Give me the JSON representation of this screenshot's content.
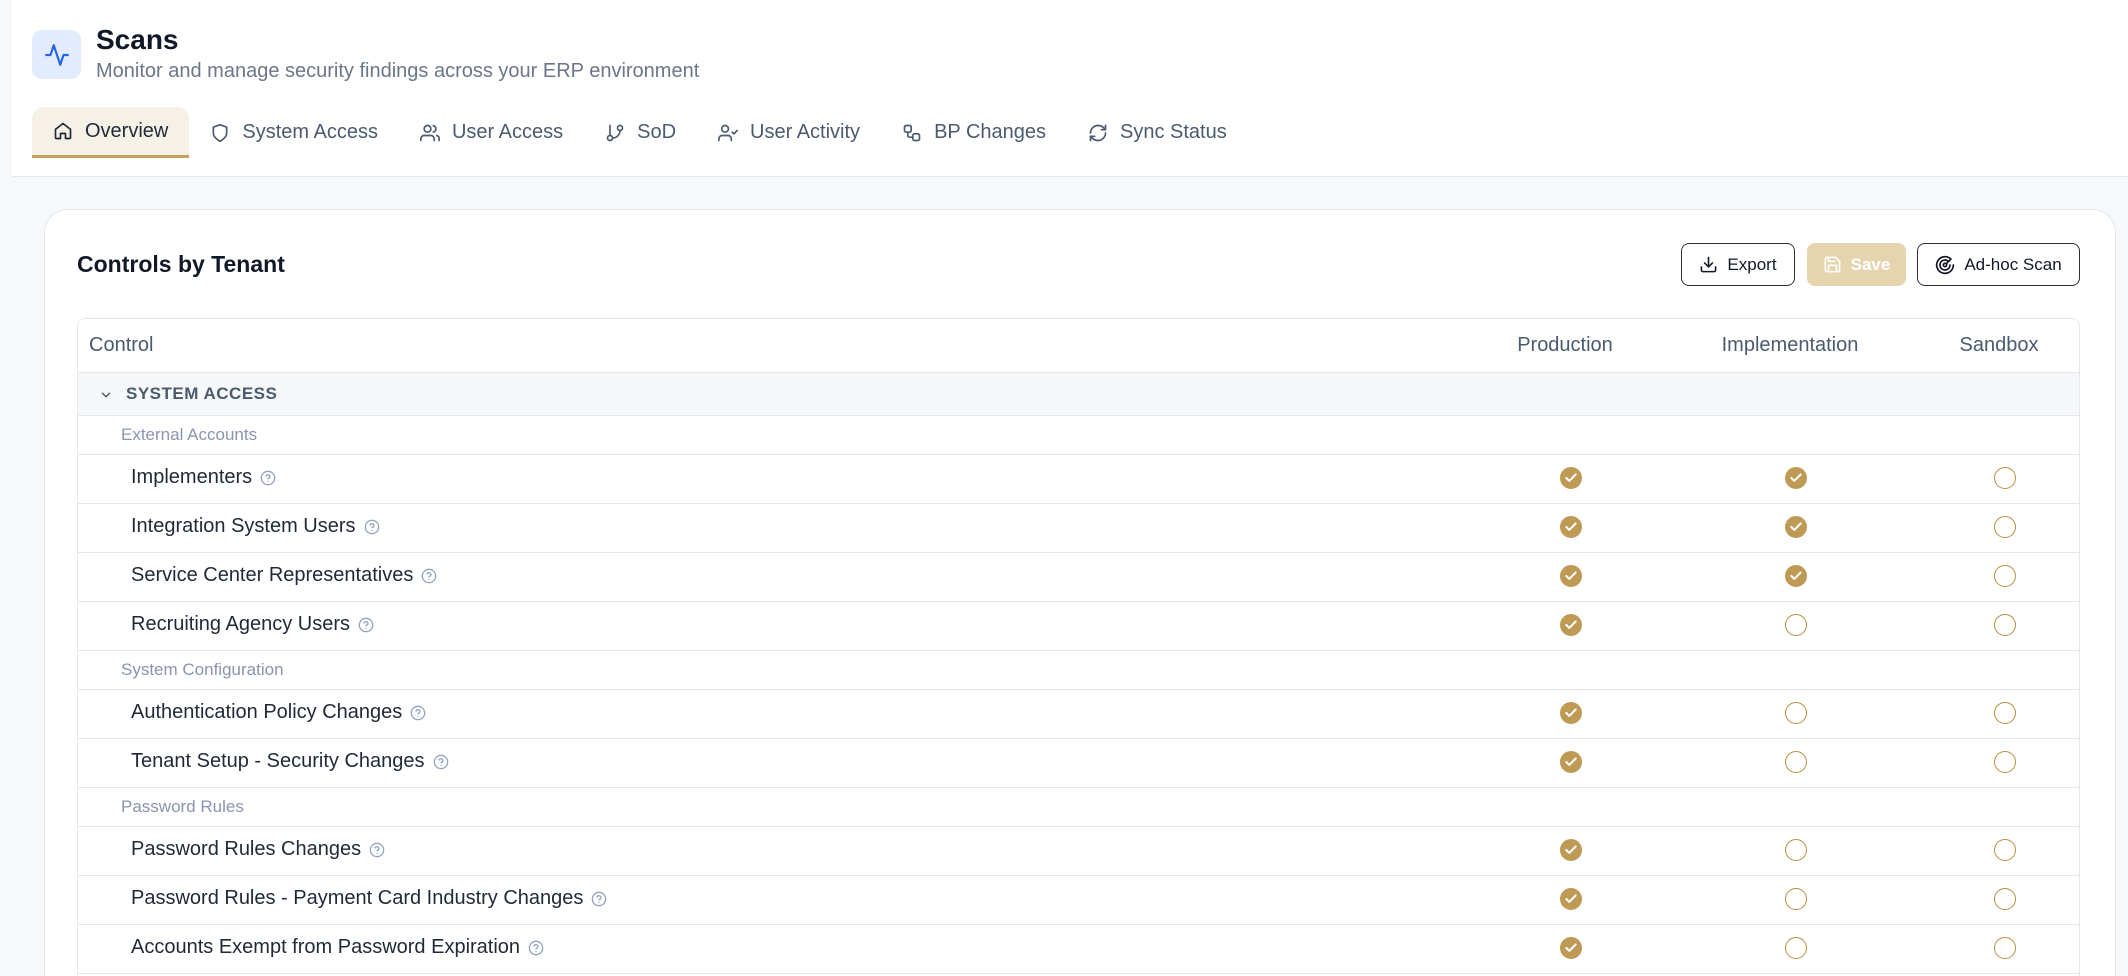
{
  "header": {
    "title": "Scans",
    "subtitle": "Monitor and manage security findings across your ERP environment"
  },
  "tabs": [
    {
      "label": "Overview",
      "icon": "home-icon",
      "active": true
    },
    {
      "label": "System Access",
      "icon": "shield-icon",
      "active": false
    },
    {
      "label": "User Access",
      "icon": "users-icon",
      "active": false
    },
    {
      "label": "SoD",
      "icon": "git-branch-icon",
      "active": false
    },
    {
      "label": "User Activity",
      "icon": "user-check-icon",
      "active": false
    },
    {
      "label": "BP Changes",
      "icon": "workflow-icon",
      "active": false
    },
    {
      "label": "Sync Status",
      "icon": "refresh-icon",
      "active": false
    }
  ],
  "card": {
    "title": "Controls by Tenant",
    "export_label": "Export",
    "save_label": "Save",
    "adhoc_label": "Ad-hoc Scan"
  },
  "table": {
    "columns": [
      "Control",
      "Production",
      "Implementation",
      "Sandbox"
    ],
    "section": "SYSTEM ACCESS",
    "groups": [
      {
        "name": "External Accounts",
        "controls": [
          {
            "label": "Implementers",
            "production": true,
            "implementation": true,
            "sandbox": false
          },
          {
            "label": "Integration System Users",
            "production": true,
            "implementation": true,
            "sandbox": false
          },
          {
            "label": "Service Center Representatives",
            "production": true,
            "implementation": true,
            "sandbox": false
          },
          {
            "label": "Recruiting Agency Users",
            "production": true,
            "implementation": false,
            "sandbox": false
          }
        ]
      },
      {
        "name": "System Configuration",
        "controls": [
          {
            "label": "Authentication Policy Changes",
            "production": true,
            "implementation": false,
            "sandbox": false
          },
          {
            "label": "Tenant Setup - Security Changes",
            "production": true,
            "implementation": false,
            "sandbox": false
          }
        ]
      },
      {
        "name": "Password Rules",
        "controls": [
          {
            "label": "Password Rules Changes",
            "production": true,
            "implementation": false,
            "sandbox": false
          },
          {
            "label": "Password Rules - Payment Card Industry Changes",
            "production": true,
            "implementation": false,
            "sandbox": false
          },
          {
            "label": "Accounts Exempt from Password Expiration",
            "production": true,
            "implementation": false,
            "sandbox": false
          }
        ]
      }
    ]
  },
  "colors": {
    "accent": "#be9a55",
    "accent_light": "#e5d4ad",
    "icon_blue": "#2563eb",
    "icon_bg": "#e3ecff"
  }
}
